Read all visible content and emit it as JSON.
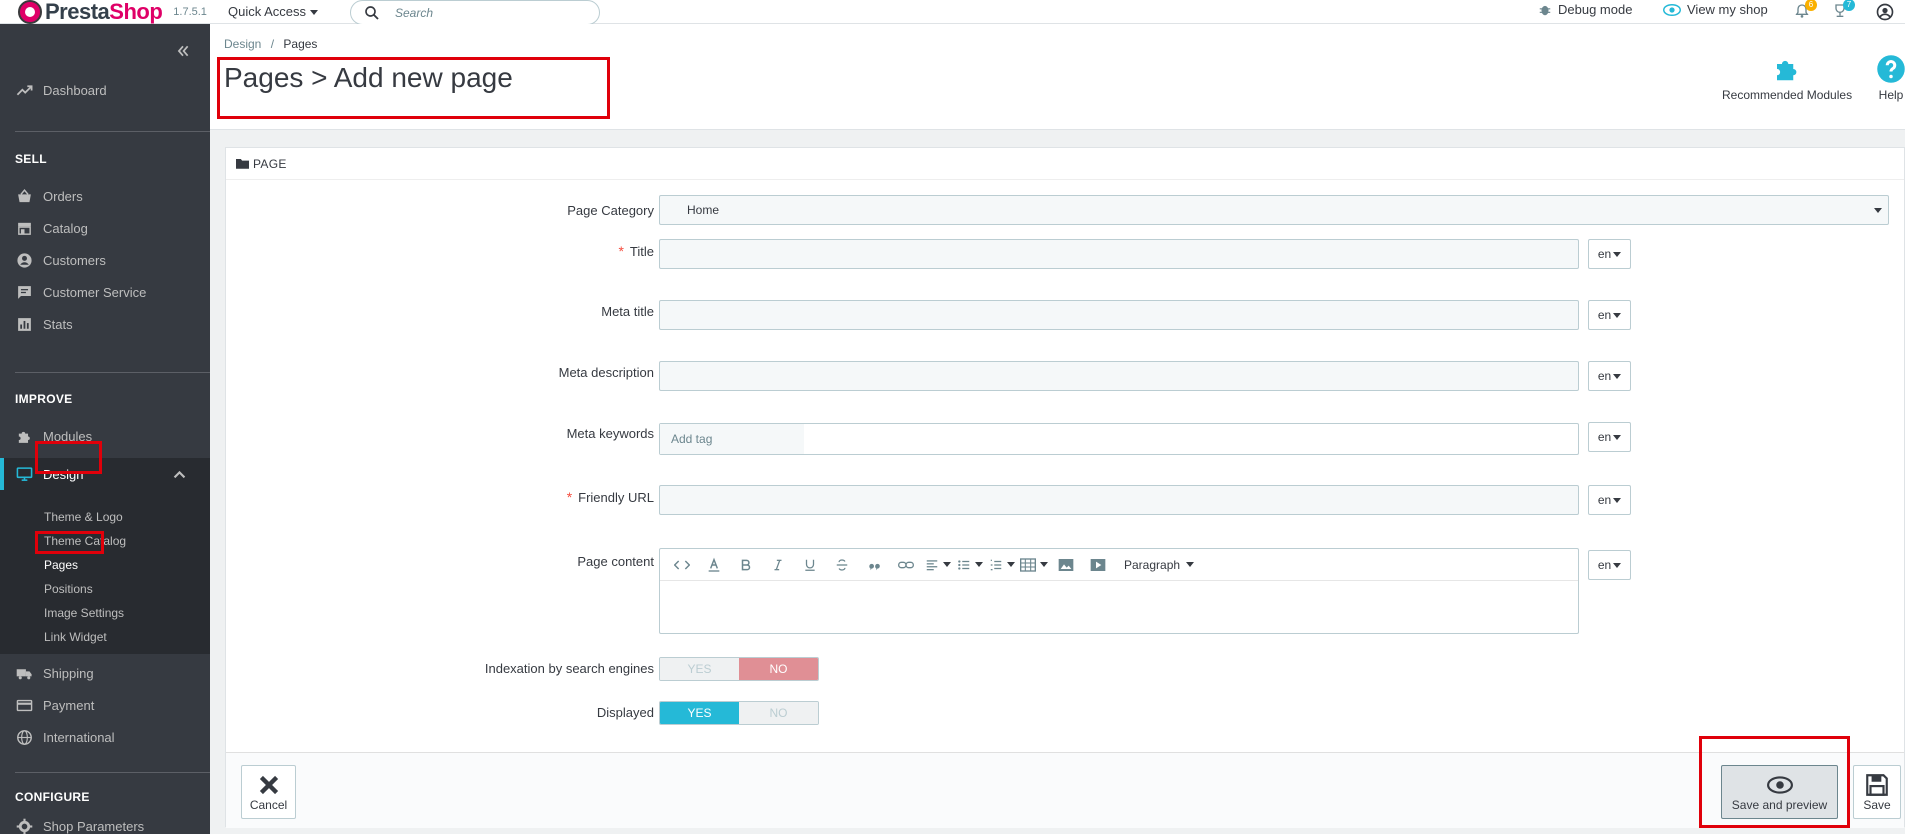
{
  "header": {
    "logo_left": "Presta",
    "logo_right": "Shop",
    "version": "1.7.5.1",
    "quick_access": "Quick Access",
    "search_placeholder": "Search",
    "debug_mode": "Debug mode",
    "view_my_shop": "View my shop",
    "notif_count_orders": "6",
    "notif_count_customers": "7"
  },
  "sidebar": {
    "dashboard": "Dashboard",
    "sell_title": "SELL",
    "sell_items": [
      "Orders",
      "Catalog",
      "Customers",
      "Customer Service",
      "Stats"
    ],
    "improve_title": "IMPROVE",
    "modules": "Modules",
    "design": "Design",
    "design_sub": [
      "Theme & Logo",
      "Theme Catalog",
      "Pages",
      "Positions",
      "Image Settings",
      "Link Widget"
    ],
    "after_items": [
      "Shipping",
      "Payment",
      "International"
    ],
    "configure_title": "CONFIGURE",
    "shop_parameters": "Shop Parameters"
  },
  "toolbar": {
    "breadcrumb_root": "Design",
    "breadcrumb_sep": "/",
    "breadcrumb_current": "Pages",
    "title": "Pages > Add new page",
    "recommended_modules": "Recommended Modules",
    "help": "Help"
  },
  "form": {
    "panel_title": "PAGE",
    "page_category_label": "Page Category",
    "page_category_value": "Home",
    "title_label": "Title",
    "meta_title_label": "Meta title",
    "meta_description_label": "Meta description",
    "meta_keywords_label": "Meta keywords",
    "meta_keywords_placeholder": "Add tag",
    "friendly_url_label": "Friendly URL",
    "page_content_label": "Page content",
    "paragraph": "Paragraph",
    "lang": "en",
    "indexation_label": "Indexation by search engines",
    "displayed_label": "Displayed",
    "yes": "YES",
    "no": "NO",
    "indexation_value": "NO",
    "displayed_value": "YES"
  },
  "footer": {
    "cancel": "Cancel",
    "save_and_preview": "Save and preview",
    "save": "Save"
  }
}
